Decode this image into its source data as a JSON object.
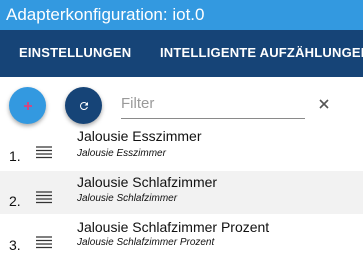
{
  "window": {
    "title": "Adapterkonfiguration: iot.0"
  },
  "tabs": [
    {
      "label": "EINSTELLUNGEN"
    },
    {
      "label": "INTELLIGENTE AUFZÄHLUNGEN"
    }
  ],
  "toolbar": {
    "add_icon": "plus-icon",
    "refresh_icon": "refresh-icon",
    "filter_placeholder": "Filter",
    "filter_value": "",
    "clear_icon": "close-icon"
  },
  "colors": {
    "title_bar": "#3399e0",
    "tab_bar": "#164477",
    "add_button": "#3399e0",
    "add_icon": "#e0407a",
    "refresh_button": "#164477",
    "row_alt": "#f2f2f2"
  },
  "enums": [
    {
      "number": "1.",
      "name": "Jalousie Esszimmer",
      "sub": "Jalousie Esszimmer",
      "icon": "drag-handle-icon"
    },
    {
      "number": "2.",
      "name": "Jalousie Schlafzimmer",
      "sub": "Jalousie Schlafzimmer",
      "icon": "drag-handle-icon"
    },
    {
      "number": "3.",
      "name": "Jalousie Schlafzimmer Prozent",
      "sub": "Jalousie Schlafzimmer Prozent",
      "icon": "drag-handle-icon"
    }
  ]
}
